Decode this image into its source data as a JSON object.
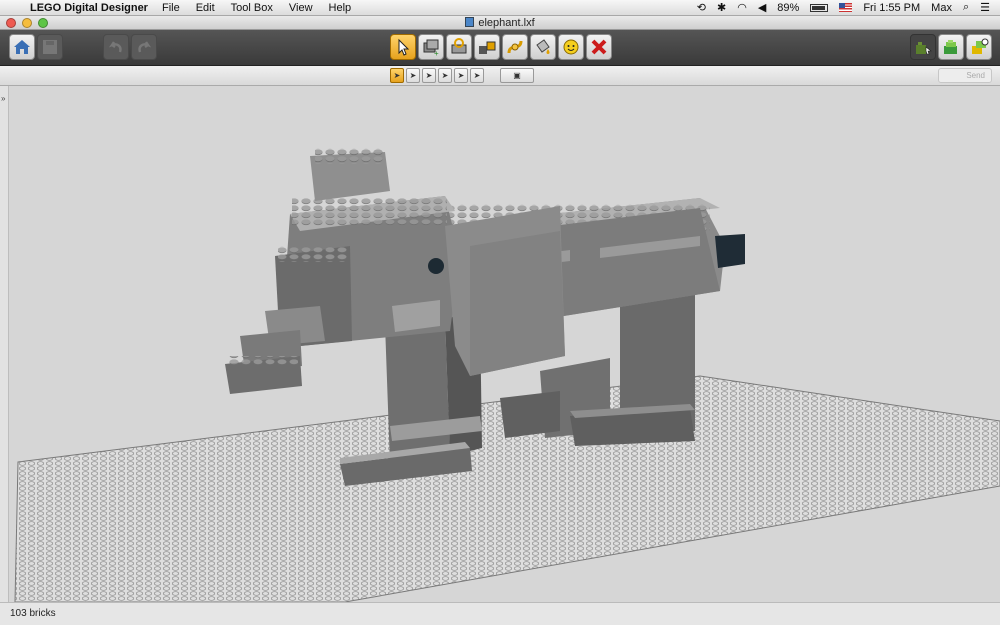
{
  "menubar": {
    "app_name": "LEGO Digital Designer",
    "menus": [
      "File",
      "Edit",
      "Tool Box",
      "View",
      "Help"
    ],
    "battery": "89%",
    "clock": "Fri 1:55 PM",
    "user": "Max"
  },
  "window": {
    "title": "elephant.lxf"
  },
  "toolbar": {
    "tools": [
      "home-icon",
      "save-icon",
      "undo-icon",
      "redo-icon",
      "select-tool-icon",
      "clone-tool-icon",
      "hinge-tool-icon",
      "hinge-align-tool-icon",
      "flex-tool-icon",
      "paint-bucket-icon",
      "decoration-tool-icon",
      "delete-tool-icon",
      "build-mode-icon",
      "view-mode-icon"
    ]
  },
  "subbar": {
    "send_label": "Send"
  },
  "status": {
    "brick_count": "103 bricks"
  },
  "colors": {
    "brick_light": "#a0a0a0",
    "brick_mid": "#7a7a7a",
    "brick_dark": "#5a5a5a",
    "baseplate": "#dcdcdc",
    "accent_active": "#f0b02c"
  }
}
